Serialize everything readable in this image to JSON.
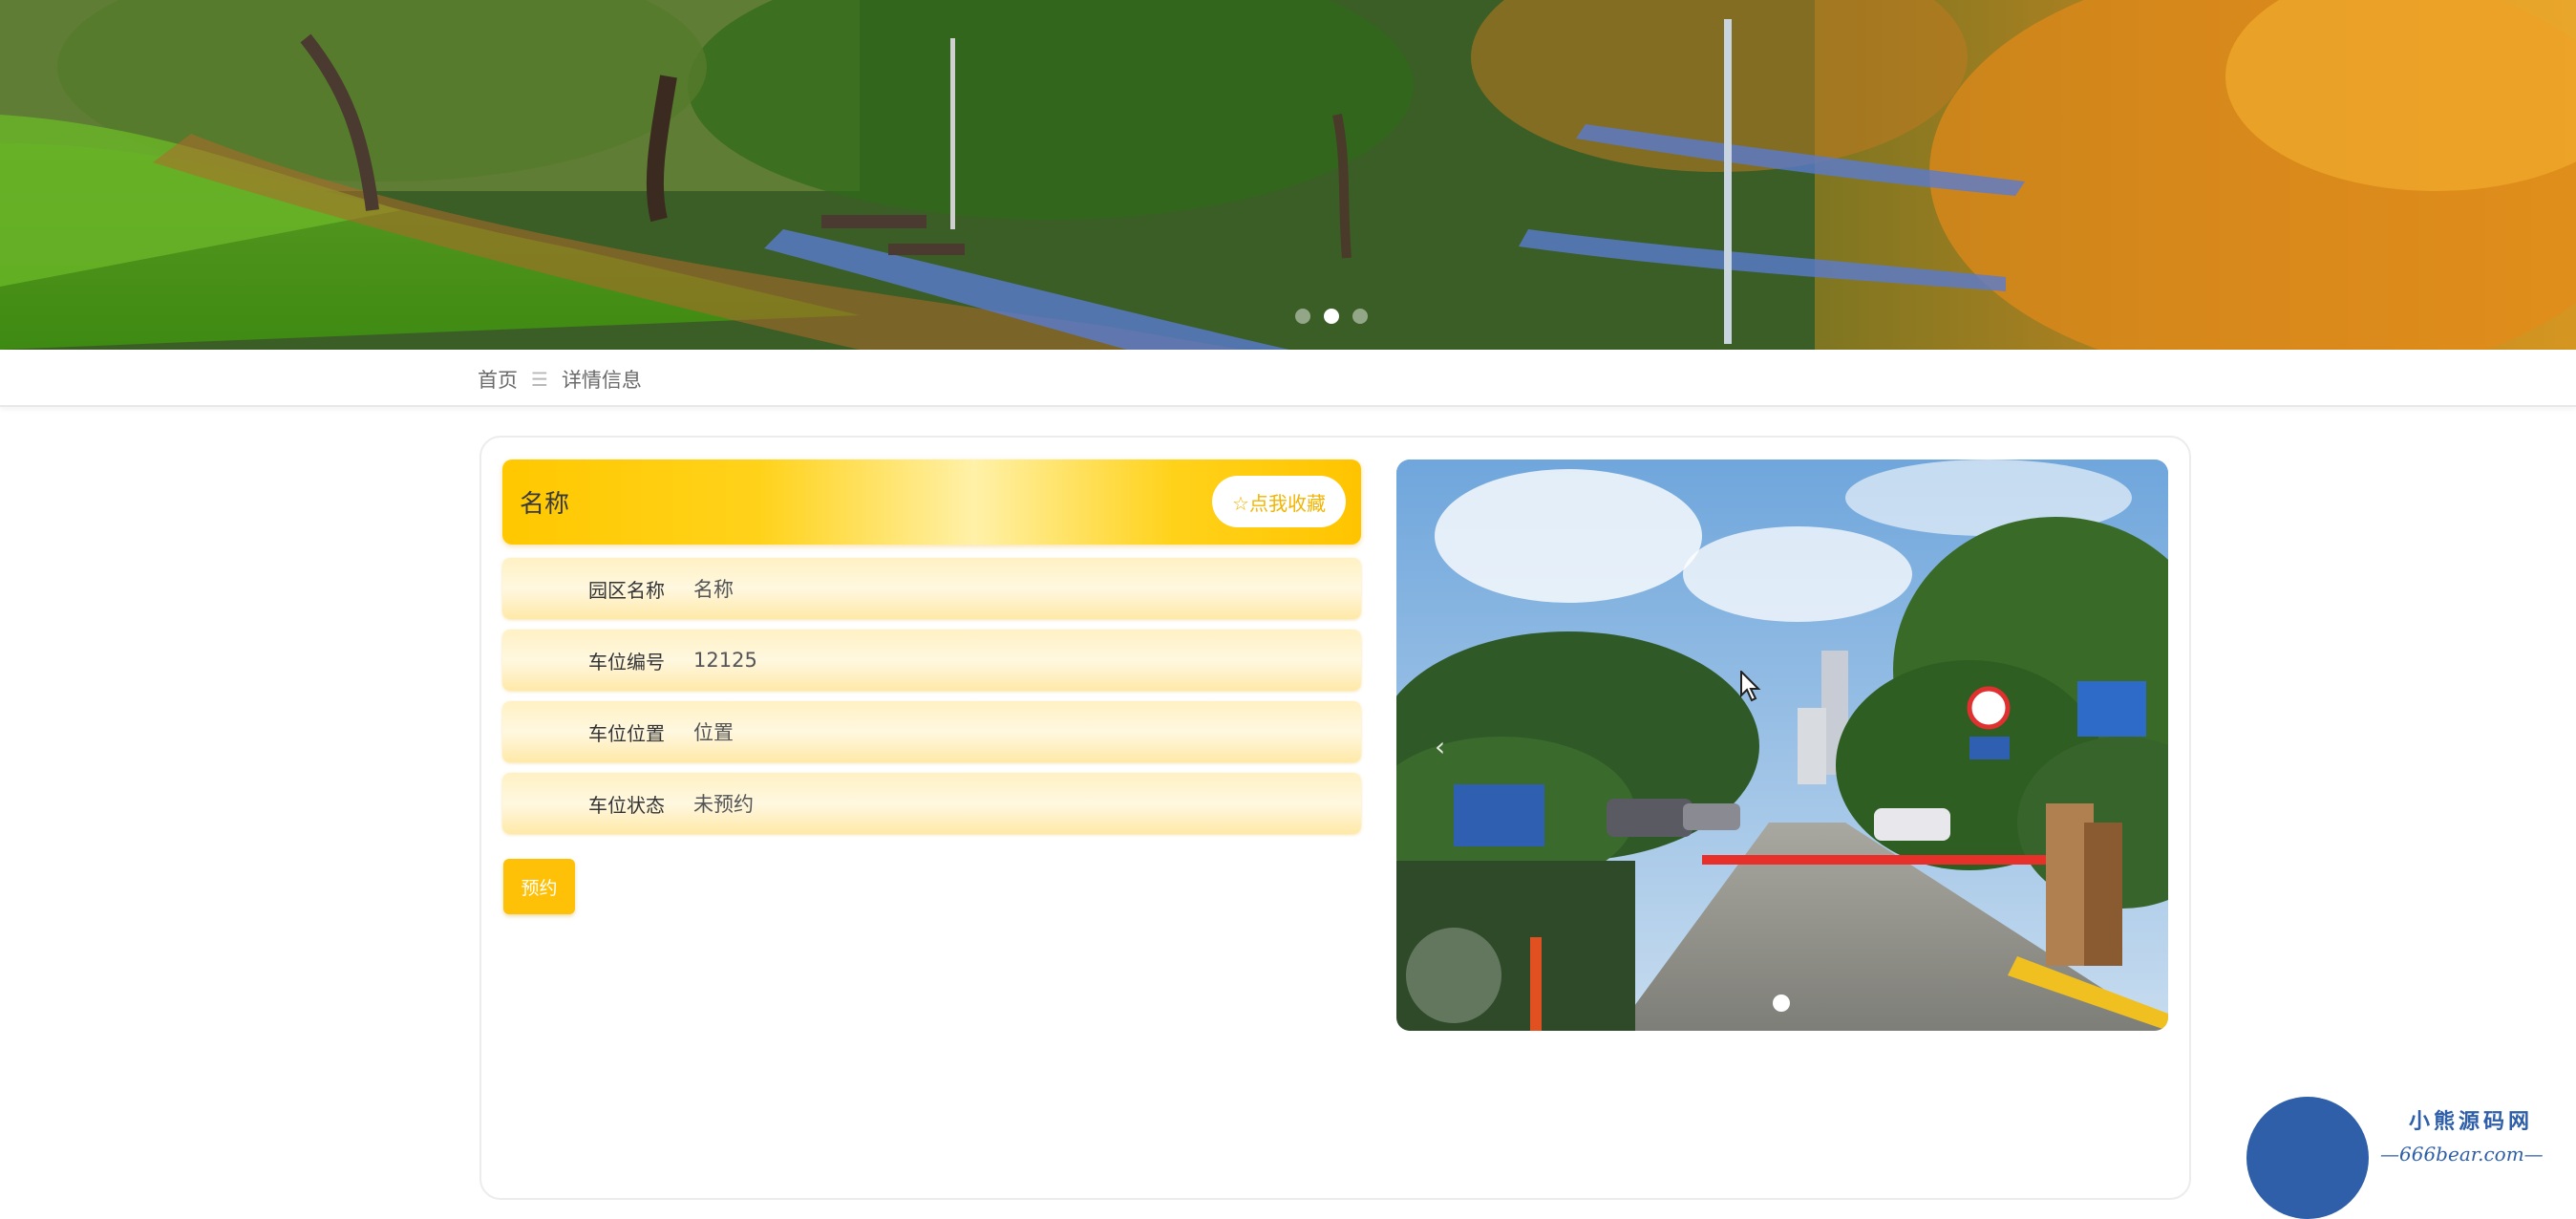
{
  "breadcrumb": {
    "home": "首页",
    "separator": "☰",
    "current": "详情信息"
  },
  "detail": {
    "title": "名称",
    "favorite_label": "☆点我收藏",
    "fields": [
      {
        "label": "园区名称",
        "value": "名称"
      },
      {
        "label": "车位编号",
        "value": "12125"
      },
      {
        "label": "车位位置",
        "value": "位置"
      },
      {
        "label": "车位状态",
        "value": "未预约"
      }
    ],
    "reserve_label": "预约"
  },
  "banner": {
    "slide_count": 3,
    "active_slide": 2
  },
  "photo": {
    "prev_icon": "chevron-left-icon",
    "slide_count": 1,
    "active_slide": 1
  },
  "watermark": {
    "name": "小熊源码网",
    "url": "—666bear.com—"
  },
  "colors": {
    "accent": "#ffc107",
    "title_gradient_start": "#ffc800",
    "row_background": "#fff1c4",
    "watermark_blue": "#2e5fa8"
  }
}
